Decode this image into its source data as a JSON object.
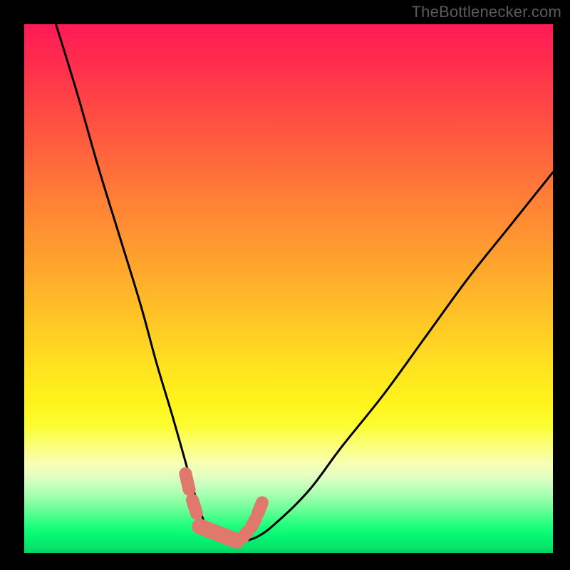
{
  "watermark": "TheBottlenecker.com",
  "colors": {
    "frame": "#000000",
    "curve": "#000000",
    "accent": "#e0786d",
    "accent_dark": "#d6665d"
  },
  "chart_data": {
    "type": "line",
    "title": "",
    "xlabel": "",
    "ylabel": "",
    "xlim": [
      0,
      100
    ],
    "ylim": [
      0,
      100
    ],
    "grid": false,
    "legend": false,
    "series": [
      {
        "name": "bottleneck-curve",
        "x": [
          6,
          10,
          14,
          18,
          22,
          25,
          28,
          30,
          32,
          34,
          36,
          38,
          40,
          44,
          48,
          54,
          60,
          68,
          76,
          84,
          92,
          100
        ],
        "values": [
          100,
          87,
          73,
          60,
          47,
          36,
          26,
          19,
          12,
          6,
          3,
          2,
          2,
          3,
          6,
          12,
          20,
          30,
          41,
          52,
          62,
          72
        ]
      }
    ],
    "accent_bounds": {
      "x_start": 30,
      "x_end": 45
    },
    "accent_segments": [
      {
        "x": [
          30.5,
          31.2
        ],
        "y": [
          15,
          12
        ]
      },
      {
        "x": [
          31.8,
          32.6
        ],
        "y": [
          10,
          7.5
        ]
      },
      {
        "x": [
          33.2,
          40.2
        ],
        "y": [
          5,
          2.3
        ]
      },
      {
        "x": [
          41.4,
          42.2
        ],
        "y": [
          3,
          4
        ]
      },
      {
        "x": [
          43.0,
          43.8
        ],
        "y": [
          5,
          6.5
        ]
      },
      {
        "x": [
          44.2,
          45.0
        ],
        "y": [
          7.5,
          9.5
        ]
      }
    ]
  }
}
